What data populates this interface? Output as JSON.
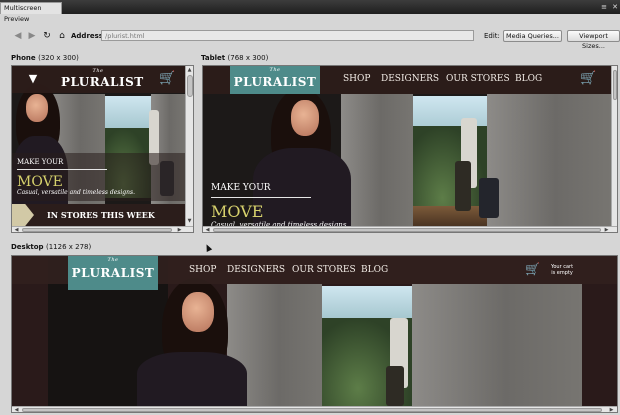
{
  "window": {
    "tab_title": "Multiscreen Preview"
  },
  "toolbar": {
    "back_glyph": "◀",
    "forward_glyph": "▶",
    "refresh_glyph": "↻",
    "home_glyph": "⌂",
    "address_label": "Address:",
    "address_value": "/plurist.html",
    "edit_label": "Edit:",
    "media_queries_label": "Media Queries...",
    "viewport_sizes_label": "Viewport Sizes..."
  },
  "phone": {
    "label": "Phone",
    "size": "(320 x 300)"
  },
  "tablet": {
    "label": "Tablet",
    "size": "(768 x 300)"
  },
  "desktop": {
    "label": "Desktop",
    "size": "(1126 x 278)"
  },
  "site": {
    "logo_the": "The",
    "logo_name": "PLURALIST",
    "nav": [
      "SHOP",
      "DESIGNERS",
      "OUR STORES",
      "BLOG"
    ],
    "cart_text_1": "Your cart",
    "cart_text_2": "is empty",
    "cart_glyph": "🛒",
    "menu_glyph": "▼",
    "promo_make": "MAKE YOUR",
    "promo_move": "MOVE",
    "promo_tagline": "Casual, versatile and timeless designs.",
    "stores_label": "IN STORES THIS WEEK"
  },
  "colors": {
    "teal_logo": "#4e8b8a",
    "move_accent": "#d6d16c",
    "header_dark": "#2d1c1a"
  }
}
